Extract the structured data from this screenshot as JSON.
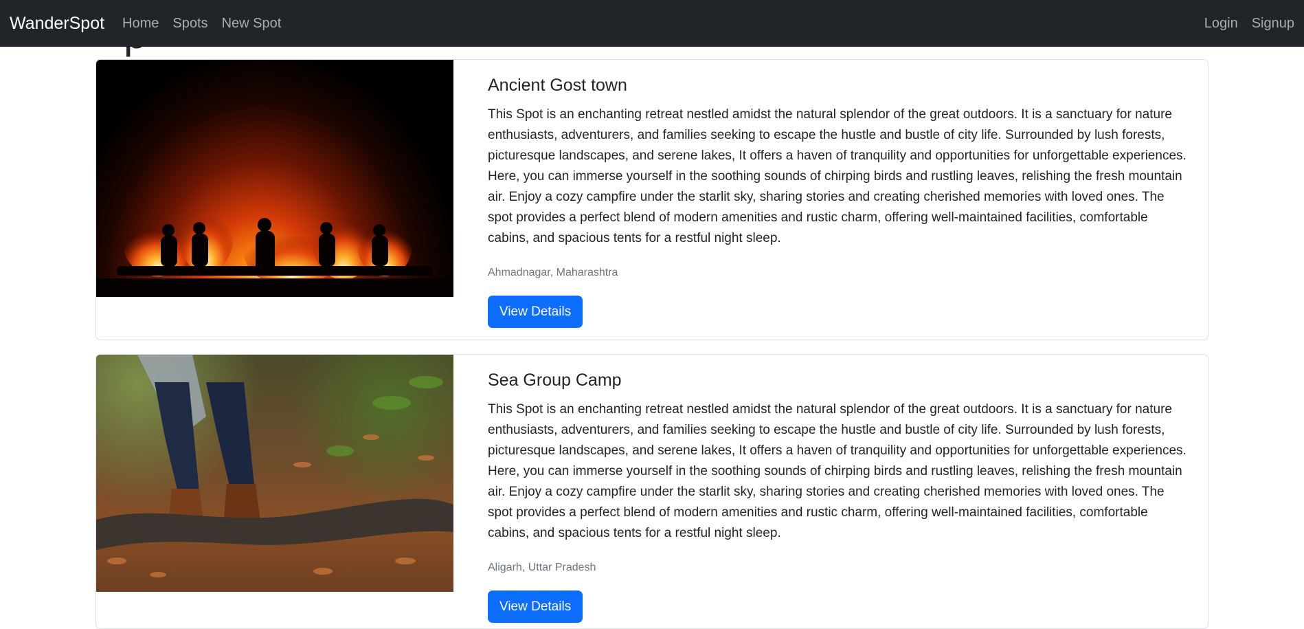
{
  "navbar": {
    "brand": "WanderSpot",
    "links": [
      "Home",
      "Spots",
      "New Spot"
    ],
    "auth_links": [
      "Login",
      "Signup"
    ]
  },
  "page": {
    "heading_fragment": "p"
  },
  "spots": [
    {
      "title": "Ancient Gost town",
      "description": "This Spot is an enchanting retreat nestled amidst the natural splendor of the great outdoors. It is a sanctuary for nature enthusiasts, adventurers, and families seeking to escape the hustle and bustle of city life. Surrounded by lush forests, picturesque landscapes, and serene lakes, It offers a haven of tranquility and opportunities for unforgettable experiences. Here, you can immerse yourself in the soothing sounds of chirping birds and rustling leaves, relishing the fresh mountain air. Enjoy a cozy campfire under the starlit sky, sharing stories and creating cherished memories with loved ones. The spot provides a perfect blend of modern amenities and rustic charm, offering well-maintained facilities, comfortable cabins, and spacious tents for a restful night sleep.",
      "location": "Ahmadnagar, Maharashtra",
      "button_label": "View Details"
    },
    {
      "title": "Sea Group Camp",
      "description": "This Spot is an enchanting retreat nestled amidst the natural splendor of the great outdoors. It is a sanctuary for nature enthusiasts, adventurers, and families seeking to escape the hustle and bustle of city life. Surrounded by lush forests, picturesque landscapes, and serene lakes, It offers a haven of tranquility and opportunities for unforgettable experiences. Here, you can immerse yourself in the soothing sounds of chirping birds and rustling leaves, relishing the fresh mountain air. Enjoy a cozy campfire under the starlit sky, sharing stories and creating cherished memories with loved ones. The spot provides a perfect blend of modern amenities and rustic charm, offering well-maintained facilities, comfortable cabins, and spacious tents for a restful night sleep.",
      "location": "Aligarh, Uttar Pradesh",
      "button_label": "View Details"
    }
  ],
  "colors": {
    "navbar_bg": "#212529",
    "primary": "#0d6efd",
    "muted": "#6c757d",
    "border": "#dee2e6"
  }
}
